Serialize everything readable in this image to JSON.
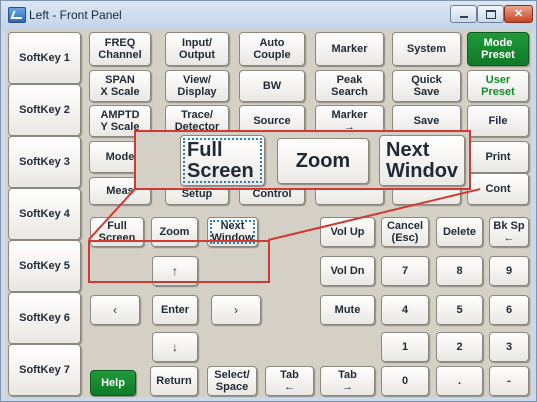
{
  "window": {
    "title": "Left - Front Panel"
  },
  "softkeys": [
    "SoftKey 1",
    "SoftKey 2",
    "SoftKey 3",
    "SoftKey 4",
    "SoftKey 5",
    "SoftKey 6",
    "SoftKey 7"
  ],
  "keys": {
    "freq_channel": "FREQ\nChannel",
    "input_output": "Input/\nOutput",
    "auto_couple": "Auto\nCouple",
    "marker": "Marker",
    "system": "System",
    "mode_preset": "Mode\nPreset",
    "span_x_scale": "SPAN\nX Scale",
    "view_display": "View/\nDisplay",
    "bw": "BW",
    "peak_search": "Peak\nSearch",
    "quick_save": "Quick\nSave",
    "user_preset": "User\nPreset",
    "amptd_y_scale": "AMPTD\nY Scale",
    "trace_detector": "Trace/\nDetector",
    "source": "Source",
    "marker_arrow": "Marker\n→",
    "save": "Save",
    "file": "File",
    "mode": "Mode",
    "print": "Print",
    "meas": "Meas",
    "setup": "Setup",
    "control": "Control",
    "cont": "Cont",
    "full_screen": "Full\nScreen",
    "zoom": "Zoom",
    "next_window": "Next\nWindow",
    "vol_up": "Vol Up",
    "cancel_esc": "Cancel\n(Esc)",
    "delete": "Delete",
    "bk_sp": "Bk Sp\n←",
    "vol_dn": "Vol Dn",
    "mute": "Mute",
    "enter": "Enter",
    "help": "Help",
    "return": "Return",
    "select_space": "Select/\nSpace",
    "tab_back": "Tab\n←",
    "tab_forward": "Tab\n→",
    "up_arrow": "↑",
    "down_arrow": "↓",
    "left_arrow": "‹",
    "right_arrow": "›"
  },
  "numpad": [
    "7",
    "8",
    "9",
    "4",
    "5",
    "6",
    "1",
    "2",
    "3",
    "0",
    ".",
    "-"
  ],
  "zoomed_callout": {
    "full_screen": "Full\nScreen",
    "zoom": "Zoom",
    "next_window": "Next\nWindov"
  },
  "colors": {
    "accent_green": "#118a2b",
    "callout_red": "#d03a32",
    "panel_bg": "#d5d0c6"
  }
}
